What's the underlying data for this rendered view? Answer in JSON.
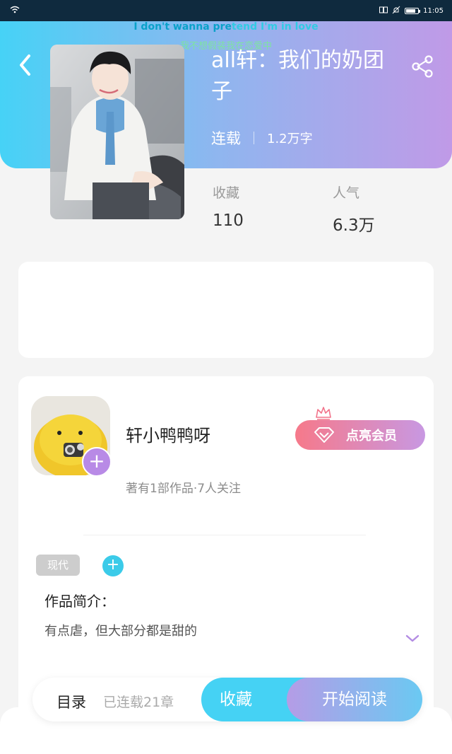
{
  "status_bar": {
    "time": "11:05",
    "battery_level": 0.8
  },
  "lyrics": {
    "line1_highlight": "I don't wanna pre",
    "line1_rest": "tend I'm in love",
    "line2": "我不想假装我在恋爱中"
  },
  "book": {
    "title": "all轩：我们的奶团子",
    "status": "连载",
    "word_count": "1.2万字"
  },
  "stats": {
    "favorites_label": "收藏",
    "favorites_value": "110",
    "popularity_label": "人气",
    "popularity_value": "6.3万"
  },
  "author": {
    "name": "轩小鸭鸭呀",
    "meta": "著有1部作品·7人关注",
    "follow_symbol": "+",
    "vip_label": "点亮会员"
  },
  "tags": {
    "items": [
      "现代"
    ],
    "add_symbol": "+"
  },
  "intro": {
    "label": "作品简介：",
    "text": "有点虐，但大部分都是甜的"
  },
  "bottom_bar": {
    "toc_label": "目录",
    "chapter_count": "已连载21章",
    "collect_label": "收藏",
    "read_label": "开始阅读"
  },
  "colors": {
    "header_start": "#46d2f6",
    "header_end": "#c09ae7",
    "accent_cyan": "#45d2f4",
    "accent_purple": "#b88ae6",
    "vip_pink": "#f6798a"
  }
}
